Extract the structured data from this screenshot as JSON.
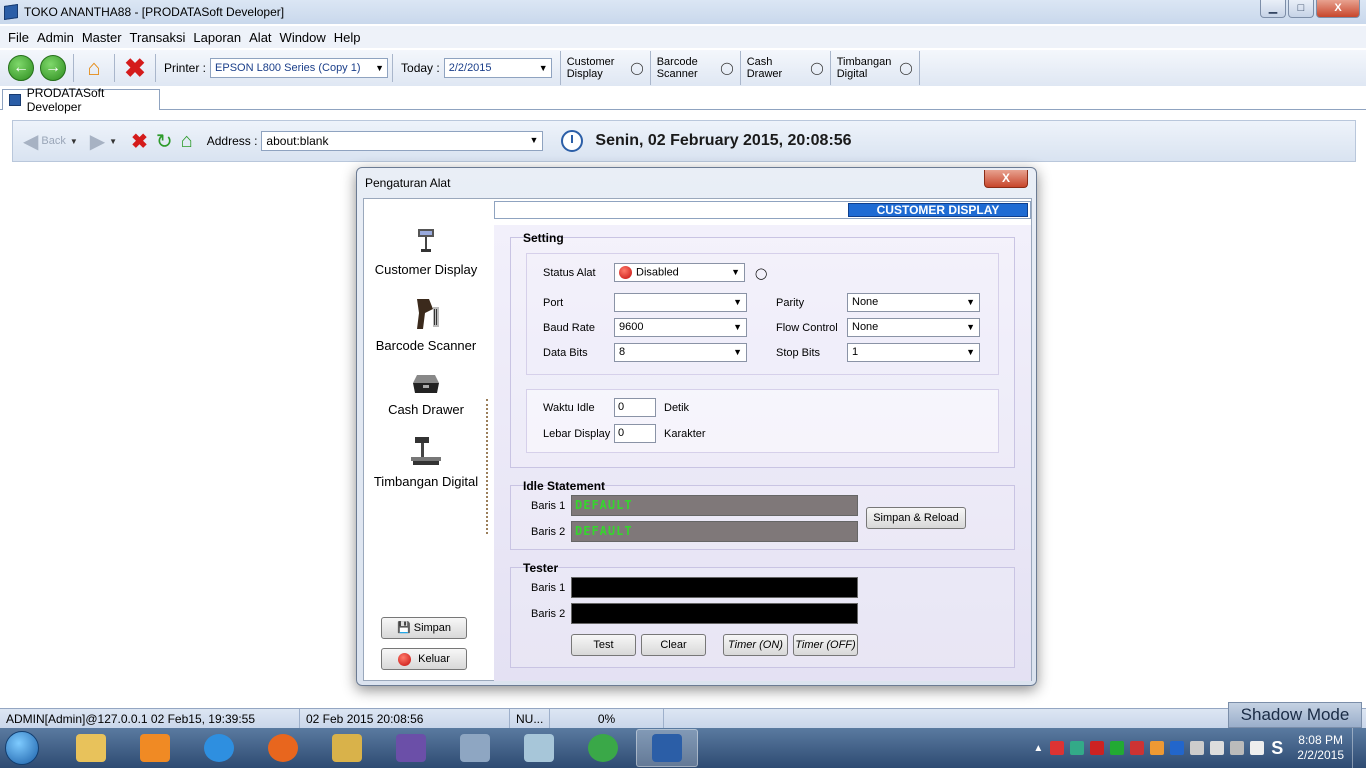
{
  "window": {
    "title": "TOKO ANANTHA88 - [PRODATASoft Developer]",
    "min": "▁",
    "max": "□",
    "close": "X"
  },
  "menu": [
    "File",
    "Admin",
    "Master",
    "Transaksi",
    "Laporan",
    "Alat",
    "Window",
    "Help"
  ],
  "toolbar": {
    "printer_label": "Printer :",
    "printer_value": "EPSON L800 Series (Copy 1)",
    "today_label": "Today :",
    "today_value": "2/2/2015",
    "devices": [
      {
        "line1": "Customer",
        "line2": "Display"
      },
      {
        "line1": "Barcode",
        "line2": "Scanner"
      },
      {
        "line1": "Cash",
        "line2": "Drawer"
      },
      {
        "line1": "Timbangan",
        "line2": "Digital"
      }
    ]
  },
  "tab": {
    "label": "PRODATASoft Developer"
  },
  "nav": {
    "back_label": "Back",
    "address_label": "Address :",
    "address_value": "about:blank",
    "datetime": "Senin, 02 February 2015, 20:08:56"
  },
  "dialog": {
    "title": "Pengaturan Alat",
    "close": "X",
    "sidebar": [
      {
        "label": "Customer Display",
        "icon": "customer-display-icon"
      },
      {
        "label": "Barcode Scanner",
        "icon": "barcode-scanner-icon"
      },
      {
        "label": "Cash Drawer",
        "icon": "cash-drawer-icon"
      },
      {
        "label": "Timbangan Digital",
        "icon": "scale-icon"
      }
    ],
    "save_button": "Simpan",
    "exit_button": "Keluar",
    "section_header": "CUSTOMER DISPLAY",
    "setting": {
      "title": "Setting",
      "status_label": "Status Alat",
      "status_value": "Disabled",
      "port_label": "Port",
      "port_value": "",
      "baud_label": "Baud Rate",
      "baud_value": "9600",
      "databits_label": "Data Bits",
      "databits_value": "8",
      "parity_label": "Parity",
      "parity_value": "None",
      "flow_label": "Flow Control",
      "flow_value": "None",
      "stopbits_label": "Stop Bits",
      "stopbits_value": "1",
      "idle_label": "Waktu Idle",
      "idle_value": "0",
      "idle_unit": "Detik",
      "width_label": "Lebar Display",
      "width_value": "0",
      "width_unit": "Karakter"
    },
    "idle": {
      "title": "Idle Statement",
      "row1_label": "Baris 1",
      "row1_value": "DEFAULT",
      "row2_label": "Baris 2",
      "row2_value": "DEFAULT",
      "reload_button": "Simpan & Reload"
    },
    "tester": {
      "title": "Tester",
      "row1_label": "Baris 1",
      "row2_label": "Baris 2",
      "test_button": "Test",
      "clear_button": "Clear",
      "timer_on": "Timer (ON)",
      "timer_off": "Timer (OFF)"
    }
  },
  "status": {
    "user": "ADMIN[Admin]@127.0.0.1 02 Feb15, 19:39:55",
    "datetime": "02 Feb 2015 20:08:56",
    "num": "NU...",
    "progress": "0%",
    "shadow_mode": "Shadow Mode"
  },
  "taskbar": {
    "time": "8:08 PM",
    "date": "2/2/2015"
  },
  "colors": {
    "accent": "#1f6bd3",
    "led_green": "#36d52e",
    "titlebar": "#dbe6f4"
  }
}
